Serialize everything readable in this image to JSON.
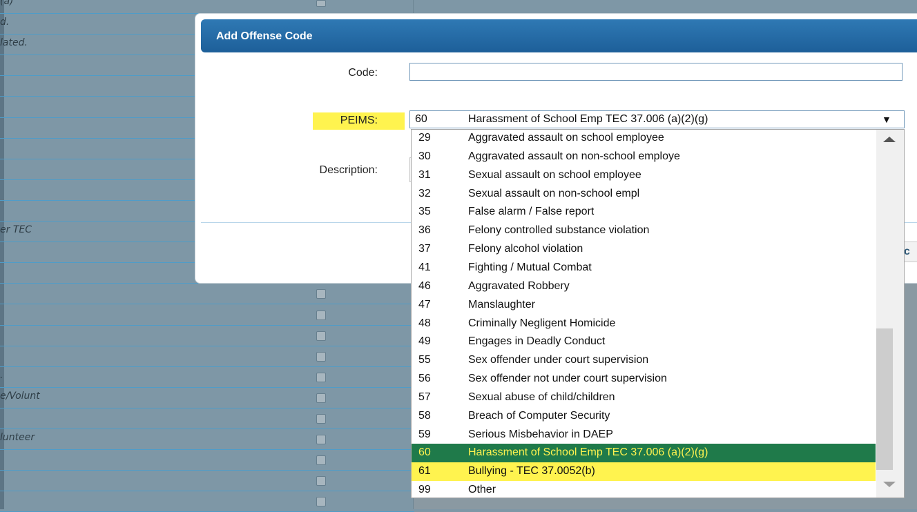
{
  "background": {
    "row_texts": [
      "(a)",
      "d.",
      "lated.",
      "",
      "",
      "",
      "",
      "",
      "",
      "",
      "",
      "er TEC",
      "",
      "",
      "",
      "",
      "",
      "",
      ".",
      "e/Volunt",
      "",
      "lunteer",
      "",
      "",
      ""
    ]
  },
  "dialog": {
    "title": "Add Offense Code",
    "code_label": "Code:",
    "code_value": "",
    "peims_label": "PEIMS:",
    "description_label": "Description:",
    "partial_button_text": "c"
  },
  "peims_select": {
    "selected_code": "60",
    "selected_label": "Harassment of School Emp TEC 37.006 (a)(2)(g)",
    "options": [
      {
        "code": "29",
        "label": "Aggravated assault on school employee"
      },
      {
        "code": "30",
        "label": "Aggravated assault on non-school employe"
      },
      {
        "code": "31",
        "label": "Sexual assault on school employee"
      },
      {
        "code": "32",
        "label": "Sexual assault on non-school empl"
      },
      {
        "code": "35",
        "label": "False alarm / False report"
      },
      {
        "code": "36",
        "label": "Felony controlled substance violation"
      },
      {
        "code": "37",
        "label": "Felony alcohol violation"
      },
      {
        "code": "41",
        "label": "Fighting / Mutual Combat"
      },
      {
        "code": "46",
        "label": "Aggravated Robbery"
      },
      {
        "code": "47",
        "label": "Manslaughter"
      },
      {
        "code": "48",
        "label": "Criminally Negligent Homicide"
      },
      {
        "code": "49",
        "label": "Engages in Deadly Conduct"
      },
      {
        "code": "55",
        "label": "Sex offender under court supervision"
      },
      {
        "code": "56",
        "label": "Sex offender not under court supervision"
      },
      {
        "code": "57",
        "label": "Sexual abuse of child/children"
      },
      {
        "code": "58",
        "label": "Breach of Computer Security"
      },
      {
        "code": "59",
        "label": "Serious Misbehavior in DAEP"
      },
      {
        "code": "60",
        "label": "Harassment of School Emp TEC 37.006 (a)(2)(g)"
      },
      {
        "code": "61",
        "label": "Bullying - TEC 37.0052(b)"
      },
      {
        "code": "99",
        "label": "Other"
      }
    ],
    "selected_index": 17,
    "hover_index": 18
  },
  "colors": {
    "header": "#1d5f99",
    "selected_option_bg": "#1f7a4a",
    "highlight_yellow": "#fff34f"
  }
}
